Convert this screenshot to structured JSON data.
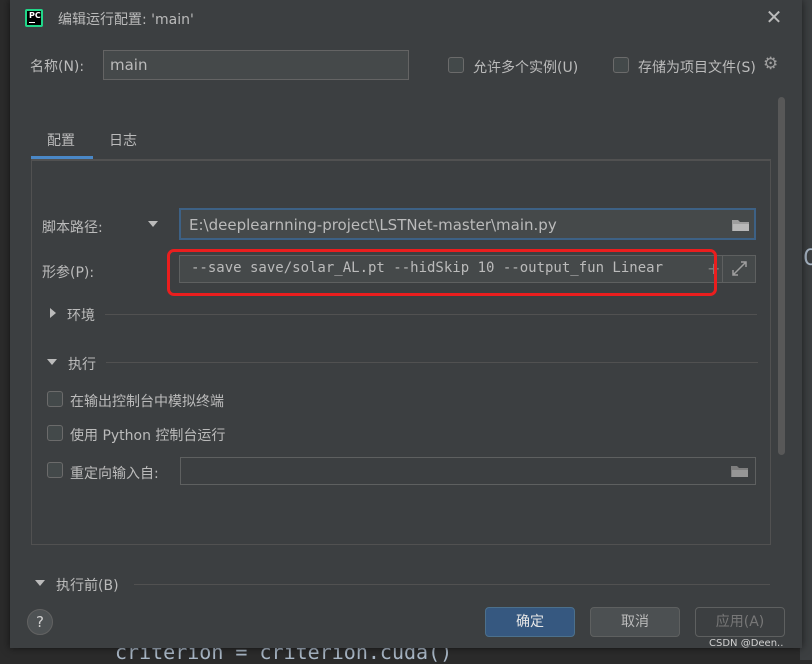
{
  "window": {
    "title": "编辑运行配置: 'main'",
    "app_icon_text": "PC"
  },
  "name_row": {
    "label": "名称(N):",
    "value": "main"
  },
  "options": {
    "allow_parallel": "允许多个实例(U)",
    "store_as_project": "存储为项目文件(S)"
  },
  "tabs": [
    {
      "label": "配置",
      "active": true
    },
    {
      "label": "日志",
      "active": false
    }
  ],
  "script": {
    "label": "脚本路径:",
    "value": "E:\\deeplearnning-project\\LSTNet-master\\main.py"
  },
  "params": {
    "label": "形参(P):",
    "value": "--save save/solar_AL.pt --hidSkip 10 --output_fun Linear"
  },
  "sections": {
    "environment": "环境",
    "execution": "执行",
    "before_launch": "执行前(B)"
  },
  "execution_options": {
    "emulate_terminal": "在输出控制台中模拟终端",
    "python_console": "使用 Python 控制台运行",
    "redirect_input": "重定向输入自:"
  },
  "buttons": {
    "help": "?",
    "ok": "确定",
    "cancel": "取消",
    "apply": "应用(A)"
  },
  "background": {
    "code": "criterion = criterion.cuda()",
    "edge_char": "C"
  },
  "watermark": "CSDN @Deen..",
  "colors": {
    "accent": "#4a88c7",
    "highlight": "#ea1e1e",
    "ok_button": "#365880"
  }
}
